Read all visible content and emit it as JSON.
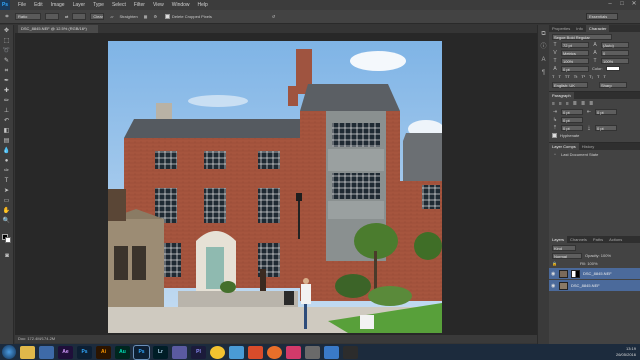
{
  "app": {
    "logo": "Ps"
  },
  "menu": [
    "File",
    "Edit",
    "Image",
    "Layer",
    "Type",
    "Select",
    "Filter",
    "View",
    "Window",
    "Help"
  ],
  "options_bar": {
    "ratio": "Ratio",
    "clear": "Clear",
    "straighten": "Straighten",
    "delete_cropped": "Delete Cropped Pixels"
  },
  "workspace": "Essentials",
  "doc_tab": "DSC_8845.NEF @ 12.5% (RGB/16*)",
  "status": "Doc: 172.4M/174.2M",
  "panels": {
    "tabs_top": [
      "Properties",
      "Info",
      "Character"
    ],
    "font_family": "Segoe Bold Regular",
    "font_size": "72 pt",
    "leading": "(Auto)",
    "kerning": "Metrics",
    "tracking": "0",
    "v_scale": "100%",
    "h_scale": "100%",
    "baseline": "0 pt",
    "color_label": "Color:",
    "language": "English: UK",
    "aa": "Sharp",
    "paragraph_tab": "Paragraph",
    "para_vals": [
      "0 pt",
      "0 pt",
      "0 pt",
      "0 pt",
      "0 pt"
    ],
    "hyphenate": "Hyphenate",
    "comps_tabs": [
      "Layer Comps",
      "History"
    ],
    "comp_item": "Last Document State",
    "layers_tabs": [
      "Layers",
      "Channels",
      "Paths",
      "Actions"
    ],
    "kind": "Kind",
    "blend": "Normal",
    "opacity": "Opacity: 100%",
    "fill": "Fill: 100%",
    "layers": [
      "DSC_8845.NEF",
      "DSC_8845.NEF"
    ]
  },
  "taskbar": {
    "apps": [
      "",
      "",
      "Ae",
      "Ps",
      "Ai",
      "Au",
      "Ps",
      "Lr",
      "",
      "Pl",
      "",
      "",
      "",
      "",
      "",
      "",
      "",
      ""
    ],
    "time": "13:19",
    "date": "26/05/2016"
  },
  "colors": {
    "accent": "#4b6a9b",
    "brick": "#a4523c",
    "sky": "#a9cdec"
  }
}
